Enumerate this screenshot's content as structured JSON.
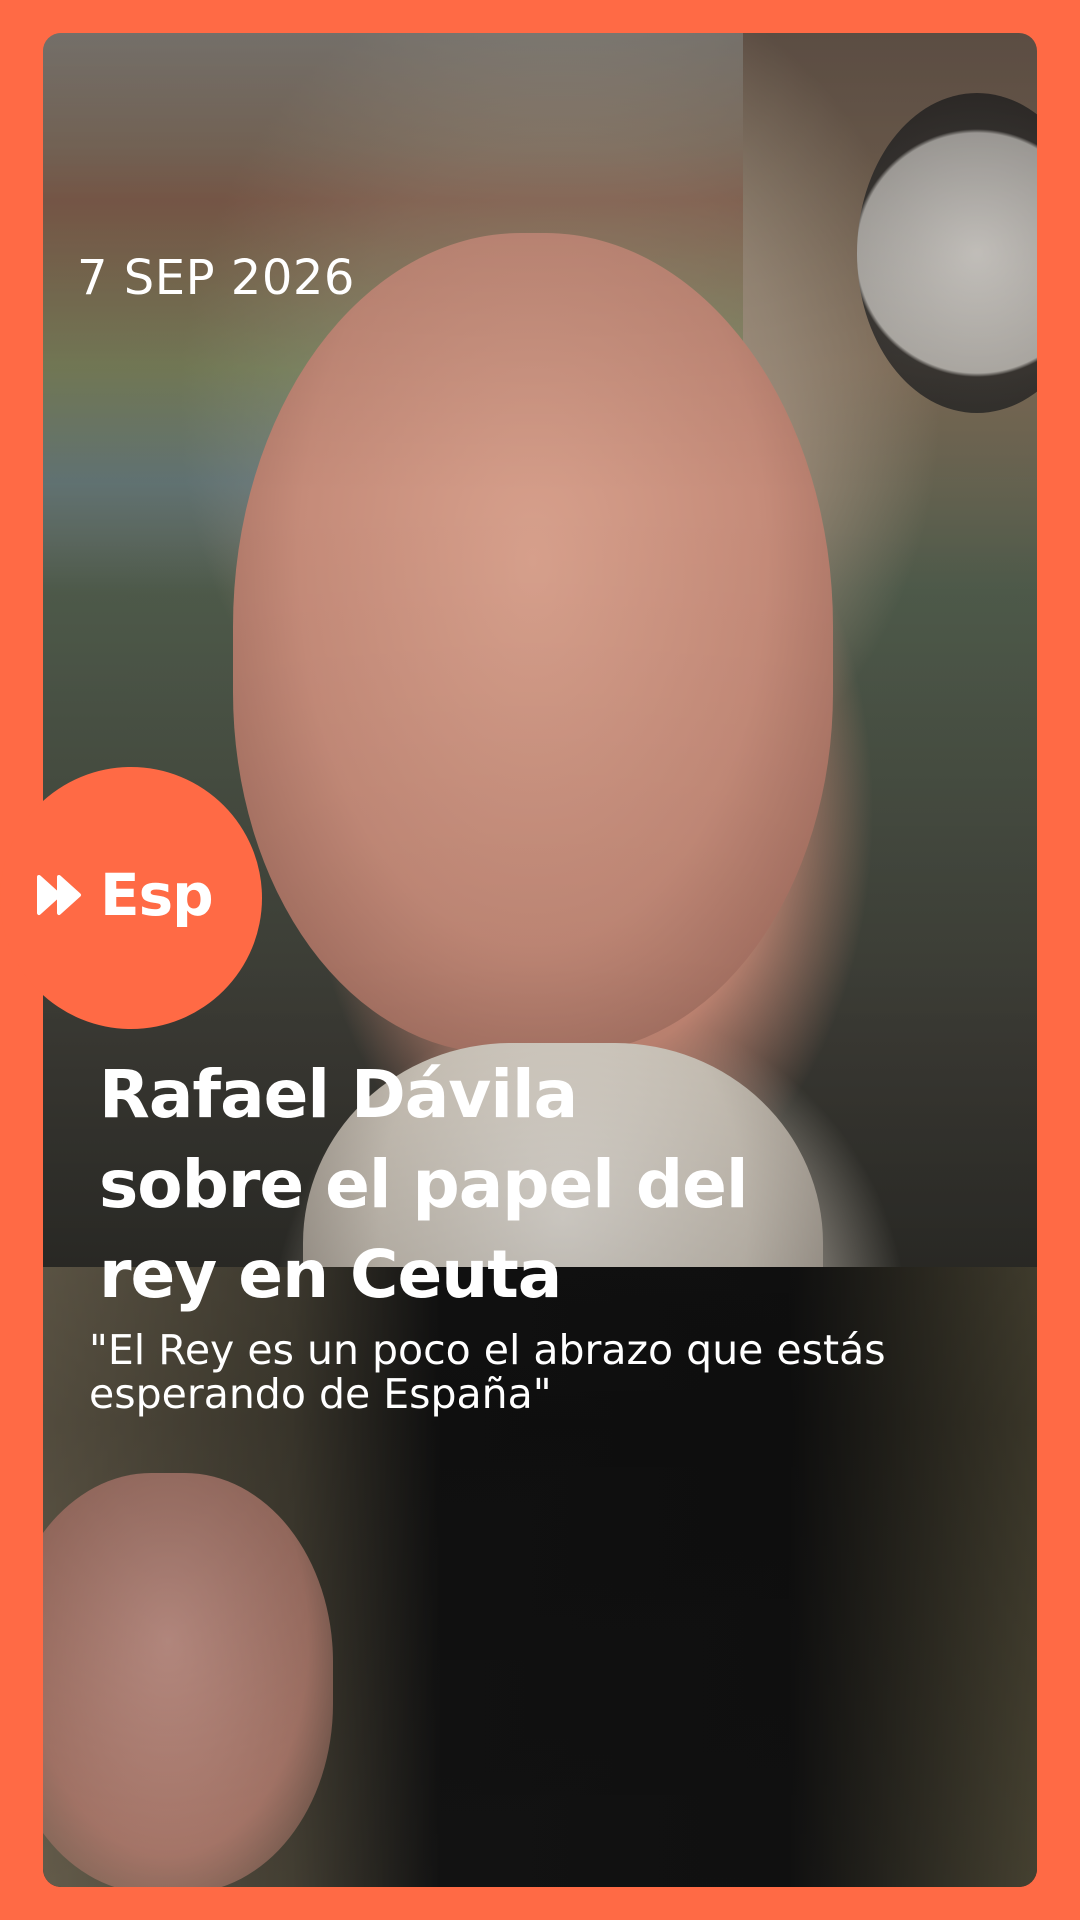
{
  "story": {
    "date": "7 SEP 2026",
    "brand": {
      "label": "Esp",
      "icon": "fast-forward-icon",
      "color": "#ff6a45"
    },
    "headline_lines": [
      "Rafael Dávila",
      "sobre el papel del",
      "rey en Ceuta"
    ],
    "quote_lines": [
      "\"El Rey es un poco el abrazo que estás",
      "esperando de España\""
    ]
  }
}
